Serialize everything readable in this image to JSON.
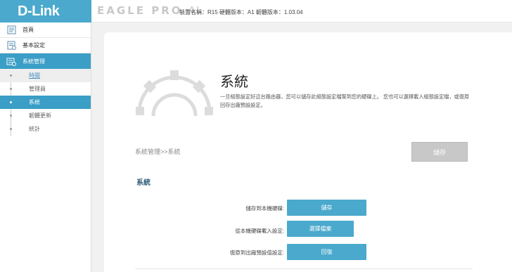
{
  "header": {
    "logo": "D-Link",
    "brand": "EAGLE PRO",
    "brand_ai": "AI",
    "device_info": "裝置名稱：R15 硬體版本：A1 韌體版本：1.03.04"
  },
  "sidebar": {
    "items": [
      {
        "label": "首頁",
        "icon": "home-icon"
      },
      {
        "label": "基本設定",
        "icon": "settings-list-icon"
      },
      {
        "label": "系統管理",
        "icon": "management-icon"
      }
    ],
    "sub_items": [
      {
        "label": "時間"
      },
      {
        "label": "管理員"
      },
      {
        "label": "系統"
      },
      {
        "label": "韌體更新"
      },
      {
        "label": "統計"
      }
    ]
  },
  "main": {
    "title": "系統",
    "description": "一旦組態設定好這台路由器，您可以儲存此組態設定檔案到您的硬碟上。 您也可以選擇載入組態設定檔，或復原回存出廠預設設定。",
    "breadcrumb": "系統管理>>系統",
    "save_button": "儲存",
    "section_title": "系統",
    "rows": [
      {
        "label": "儲存到本機硬碟:",
        "button": "儲存"
      },
      {
        "label": "從本機硬碟載入設定:",
        "button": "選擇檔案"
      },
      {
        "label": "復原到出廠預設值設定:",
        "button": "回復"
      }
    ]
  },
  "colors": {
    "accent": "#3a9ec6",
    "button": "#4aa9cc",
    "disabled_button": "#c8c8c8"
  }
}
